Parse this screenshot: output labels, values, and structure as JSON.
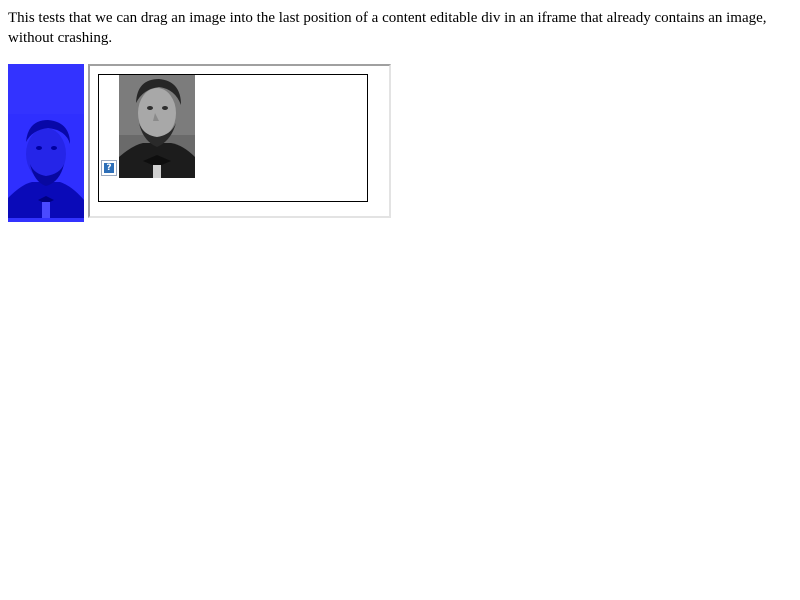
{
  "description": {
    "text": "This tests that we can drag an image into the last position of a content editable div in an iframe that already contains an image, without crashing."
  },
  "drag_source": {
    "background_color": "#3333ff",
    "image_icon": "portrait-photo"
  },
  "iframe": {
    "editable_div": {
      "image_icon": "portrait-photo",
      "broken_image_icon": "broken-image-placeholder"
    }
  }
}
